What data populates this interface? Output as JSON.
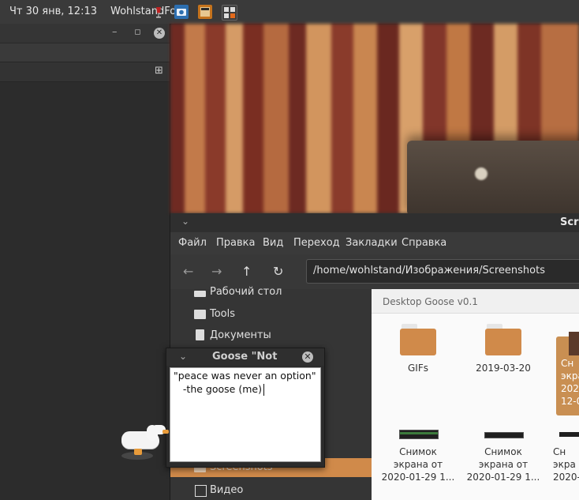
{
  "panel": {
    "clock": "Чт 30 янв, 12:13",
    "app_title": "WohlstandFox",
    "tray": [
      "wine-icon",
      "camera-icon",
      "screenshot-icon",
      "calculator-icon"
    ]
  },
  "wallpaper": {
    "colors": [
      "#6f2a22",
      "#c27a4a",
      "#d59b66"
    ]
  },
  "file_manager": {
    "title": "Scr",
    "menu": [
      "Файл",
      "Правка",
      "Вид",
      "Переход",
      "Закладки",
      "Справка"
    ],
    "path": "/home/wohlstand/Изображения/Screenshots",
    "sidebar": [
      {
        "label": "Рабочий стол",
        "icon": "desktop-folder-icon"
      },
      {
        "label": "Tools",
        "icon": "folder-icon"
      },
      {
        "label": "Документы",
        "icon": "documents-icon"
      },
      {
        "label": "Screenshots",
        "icon": "folder-icon"
      },
      {
        "label": "Видео",
        "icon": "video-icon"
      }
    ],
    "tooltip": "Desktop Goose v0.1",
    "items": [
      {
        "name": "GIFs",
        "type": "folder"
      },
      {
        "name": "2019-03-20",
        "type": "folder"
      },
      {
        "name": "Сн\nэкра\n202\n12-0",
        "type": "selected"
      },
      {
        "name": "Снимок\nэкрана от\n2020-01-29 1...",
        "type": "screenshot"
      },
      {
        "name": "Снимок\nэкрана от\n2020-01-29 1...",
        "type": "screenshot"
      },
      {
        "name": "Сн\nэкра\n2020-",
        "type": "screenshot"
      }
    ]
  },
  "note": {
    "title": "Goose \"Not",
    "lines": [
      "\"peace was never an option\"",
      "   -the goose (me)"
    ]
  },
  "accent": "#d08a4a"
}
